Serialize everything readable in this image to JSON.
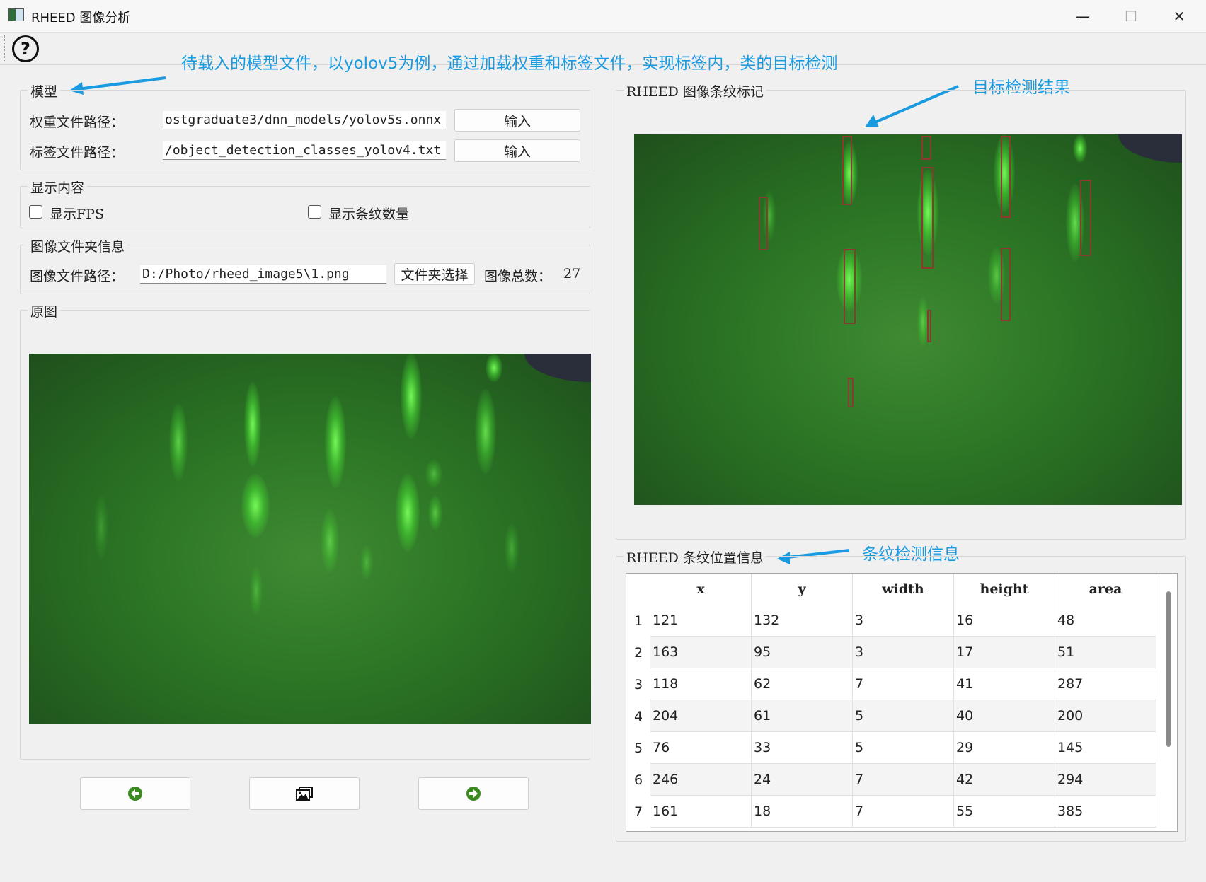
{
  "window": {
    "title": "RHEED 图像分析",
    "minimize_glyph": "—",
    "maximize_glyph": "☐",
    "close_glyph": "✕"
  },
  "toolbar": {
    "help_glyph": "?"
  },
  "annotations": {
    "model_note": "待载入的模型文件，以yolov5为例，通过加载权重和标签文件，实现标签内，类的目标检测",
    "detect_result": "目标检测结果",
    "stripe_info": "条纹检测信息"
  },
  "model_group": {
    "title": "模型",
    "weight_label": "权重文件路径：",
    "weight_value": "ostgraduate3/dnn_models/yolov5s.onnx",
    "weight_button": "输入",
    "label_label": "标签文件路径：",
    "label_value": "/object_detection_classes_yolov4.txt",
    "label_button": "输入"
  },
  "display_group": {
    "title": "显示内容",
    "show_fps": "显示FPS",
    "show_fps_checked": false,
    "show_count": "显示条纹数量",
    "show_count_checked": false
  },
  "folder_group": {
    "title": "图像文件夹信息",
    "path_label": "图像文件路径：",
    "path_value": "D:/Photo/rheed_image5\\1.png",
    "select_button": "文件夹选择",
    "count_label": "图像总数：",
    "count_value": "27"
  },
  "original_group": {
    "title": "原图"
  },
  "nav": {
    "prev_icon": "arrow-left-icon",
    "image_icon": "images-icon",
    "next_icon": "arrow-right-icon"
  },
  "marked_group": {
    "title": "RHEED 图像条纹标记"
  },
  "info_group": {
    "title": "RHEED 条纹位置信息"
  },
  "table": {
    "columns": [
      "x",
      "y",
      "width",
      "height",
      "area"
    ],
    "rows": [
      [
        "1",
        "121",
        "132",
        "3",
        "16",
        "48"
      ],
      [
        "2",
        "163",
        "95",
        "3",
        "17",
        "51"
      ],
      [
        "3",
        "118",
        "62",
        "7",
        "41",
        "287"
      ],
      [
        "4",
        "204",
        "61",
        "5",
        "40",
        "200"
      ],
      [
        "5",
        "76",
        "33",
        "5",
        "29",
        "145"
      ],
      [
        "6",
        "246",
        "24",
        "7",
        "42",
        "294"
      ],
      [
        "7",
        "161",
        "18",
        "7",
        "55",
        "385"
      ]
    ]
  },
  "colors": {
    "annotation": "#1a9be0",
    "box": "#8a3a2e",
    "rheed_green": "#2f7a27"
  }
}
